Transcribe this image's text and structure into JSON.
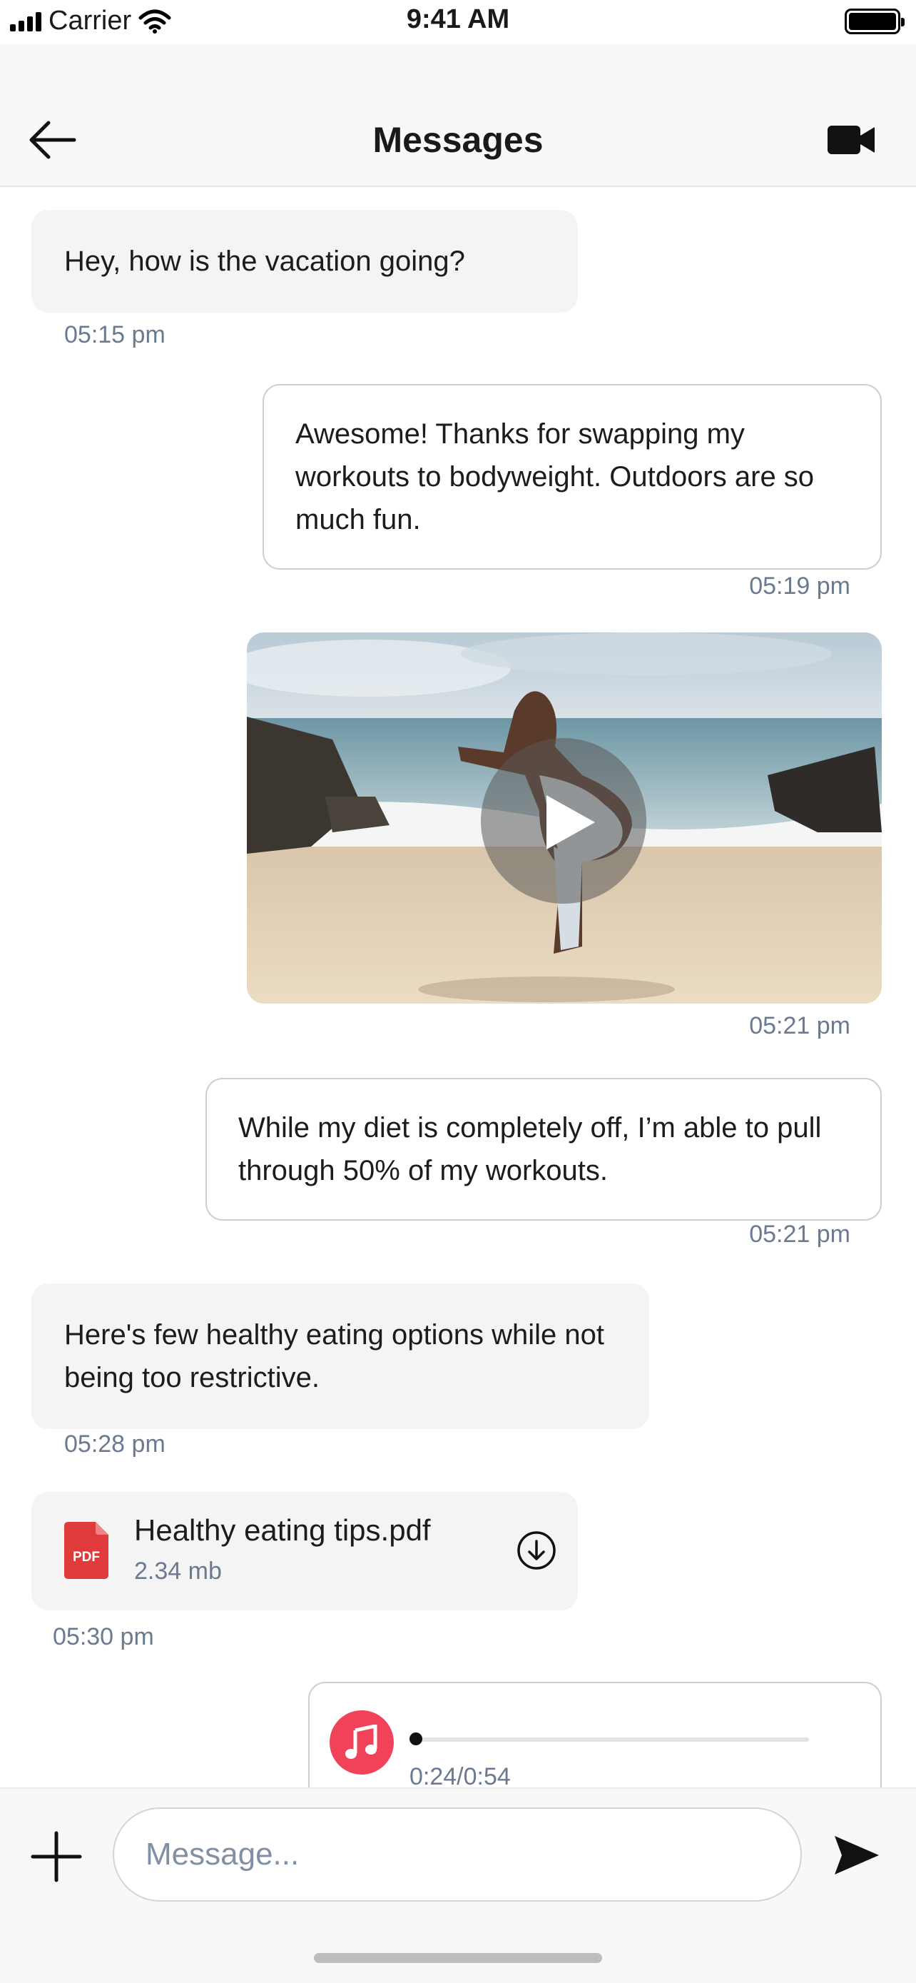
{
  "status_bar": {
    "carrier": "Carrier",
    "time": "9:41 AM",
    "icons": [
      "signal-icon",
      "wifi-icon",
      "battery-icon"
    ]
  },
  "header": {
    "title": "Messages",
    "back_icon": "back-arrow-icon",
    "video_icon": "video-camera-icon"
  },
  "messages": [
    {
      "direction": "incoming",
      "type": "text",
      "text": "Hey, how is the vacation going?",
      "time": "05:15 pm"
    },
    {
      "direction": "outgoing",
      "type": "text",
      "text": "Awesome! Thanks for swapping my workouts to bodyweight. Outdoors are so much fun.",
      "time": "05:19 pm"
    },
    {
      "direction": "outgoing",
      "type": "video",
      "thumbnail": "beach-squat-photo",
      "time": "05:21 pm"
    },
    {
      "direction": "outgoing",
      "type": "text",
      "text": "While my diet is completely off, I’m able to pull through 50% of my workouts.",
      "time": "05:21 pm"
    },
    {
      "direction": "incoming",
      "type": "text",
      "text": "Here's few healthy eating options while not being too restrictive.",
      "time": "05:28 pm"
    },
    {
      "direction": "incoming",
      "type": "file",
      "file_name": "Healthy eating tips.pdf",
      "file_size": "2.34 mb",
      "file_badge": "PDF",
      "time": "05:30 pm"
    },
    {
      "direction": "outgoing",
      "type": "audio",
      "progress_text": "0:24/0:54",
      "progress_fraction": 0.0
    }
  ],
  "composer": {
    "placeholder": "Message...",
    "add_icon": "plus-icon",
    "send_icon": "send-icon"
  },
  "colors": {
    "incoming_bubble": "#f4f4f4",
    "outgoing_border": "#cfcfcf",
    "timestamp": "#6b7a90",
    "pdf_red": "#e03b3b",
    "music_pink": "#f0435a"
  }
}
